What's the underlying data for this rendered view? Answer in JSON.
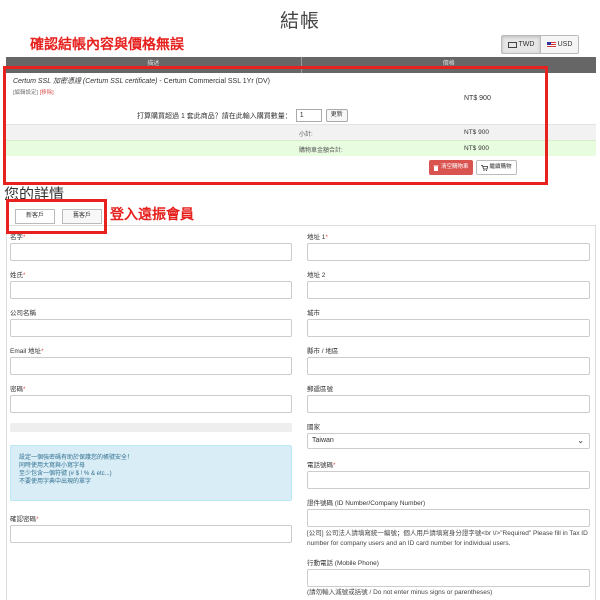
{
  "page_title": "結帳",
  "currency": {
    "twd_label": "TWD",
    "usd_label": "USD"
  },
  "annotations": {
    "top_note": "確認結帳內容與價格無誤",
    "login_note": "登入遠振會員"
  },
  "cart": {
    "header_cols": [
      "描述",
      "價格"
    ],
    "product_name_italic": "Certum SSL 加密憑證 (Certum SSL certificate)",
    "product_name_rest": " - Certum Commercial SSL 1Yr (DV)",
    "edit_link": "[編輯設定]",
    "remove_link": "[移除]",
    "product_price": "NT$ 900",
    "qty_prompt": "打算購買超過 1 套此商品？請在此輸入購買數量：",
    "qty_value": "1",
    "update_label": "更新",
    "subtotal_label": "小計:",
    "subtotal_value": "NT$ 900",
    "total_label": "購物車金額合計:",
    "total_value": "NT$ 900",
    "empty_cart": "清空購物車",
    "continue_shopping": "繼續購物"
  },
  "details": {
    "title": "您的詳情",
    "tabs": [
      "新客戶",
      "舊客戶"
    ],
    "labels": {
      "first_name": "名字",
      "last_name": "姓氏",
      "company": "公司名稱",
      "email": "Email 地址",
      "password": "密碼",
      "confirm_password": "確認密碼",
      "address1": "地址 1",
      "address2": "地址 2",
      "city": "城市",
      "state": "縣市 / 地區",
      "postcode": "郵遞區號",
      "country": "國家",
      "phone": "電話號碼",
      "id_number": "證件號碼 (ID Number/Company Number)",
      "mobile": "行動電話 (Mobile Phone)"
    },
    "country_value": "Taiwan",
    "password_tips": [
      "設定一個強密碼有助於保護您的帳號安全！",
      "同時使用大寫與小寫字母",
      "至少包含一個符號 (# $ ! % & etc...)",
      "不要使用字典中出現的單字"
    ],
    "id_help": "[公司] 公司法人請填寫統一編號；個人用戶請填寫身分證字號<br \\/>\"Required\" Please fill in Tax ID number for company users and an ID card number for individual users.",
    "mobile_help": "(請勿輸入減號或括號 / Do not enter minus signs or parentheses)"
  }
}
